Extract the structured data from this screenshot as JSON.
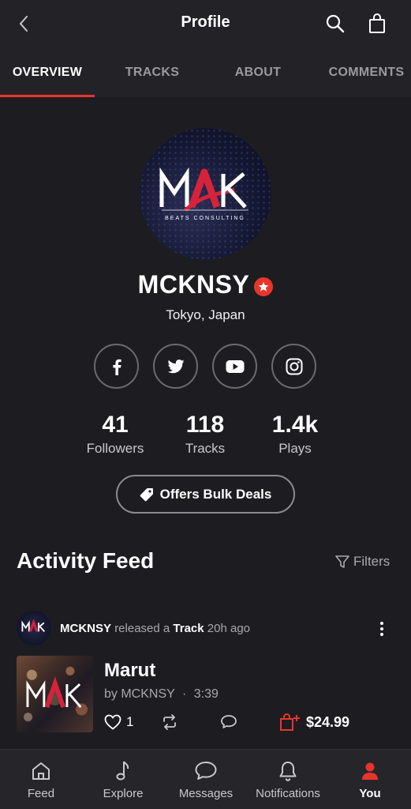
{
  "header": {
    "title": "Profile"
  },
  "tabs": [
    {
      "label": "OVERVIEW",
      "active": true
    },
    {
      "label": "TRACKS",
      "active": false
    },
    {
      "label": "ABOUT",
      "active": false
    },
    {
      "label": "COMMENTS",
      "active": false
    }
  ],
  "profile": {
    "logo_text": "MAK",
    "logo_subtext": "BEATS CONSULTING",
    "name": "MCKNSY",
    "location": "Tokyo, Japan",
    "socials": [
      "facebook-icon",
      "twitter-icon",
      "youtube-icon",
      "instagram-icon"
    ],
    "stats": [
      {
        "value": "41",
        "label": "Followers"
      },
      {
        "value": "118",
        "label": "Tracks"
      },
      {
        "value": "1.4k",
        "label": "Plays"
      }
    ],
    "bulk_deals_label": "Offers Bulk Deals"
  },
  "feed": {
    "title": "Activity Feed",
    "filters_label": "Filters",
    "items": [
      {
        "user": "MCKNSY",
        "action": "released a",
        "object": "Track",
        "time": "20h ago",
        "track_title": "Marut",
        "by_label": "by MCKNSY",
        "separator": "·",
        "duration": "3:39",
        "likes": "1",
        "price": "$24.99"
      }
    ]
  },
  "bottom_nav": [
    {
      "label": "Feed",
      "icon": "home-icon",
      "active": false
    },
    {
      "label": "Explore",
      "icon": "music-note-icon",
      "active": false
    },
    {
      "label": "Messages",
      "icon": "chat-bubble-icon",
      "active": false
    },
    {
      "label": "Notifications",
      "icon": "bell-icon",
      "active": false
    },
    {
      "label": "You",
      "icon": "user-icon",
      "active": true
    }
  ],
  "colors": {
    "accent": "#e8352c",
    "background": "#1d1d21",
    "bar": "#232327"
  }
}
